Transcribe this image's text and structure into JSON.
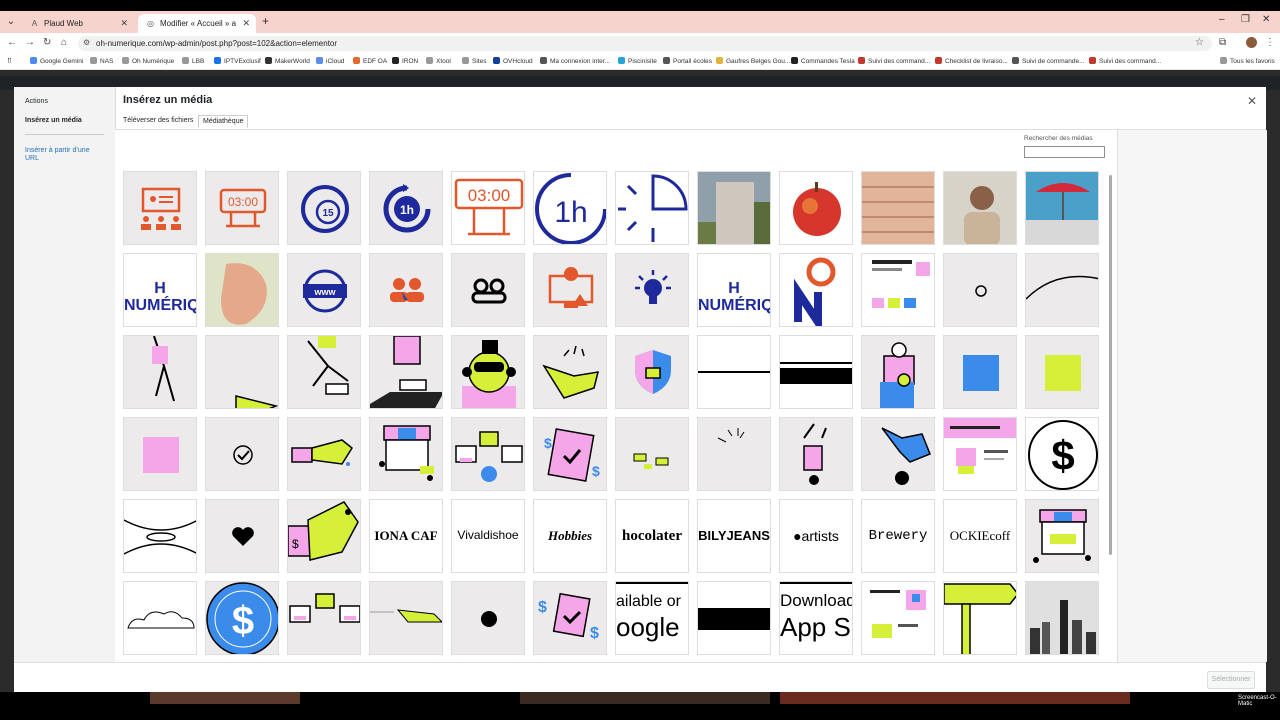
{
  "browser": {
    "tabs": [
      {
        "title": "Plaud Web",
        "icon": "plaud-icon"
      },
      {
        "title": "Modifier « Accueil » avec Elementor",
        "icon": "elementor-icon"
      }
    ],
    "url": "oh-numerique.com/wp-admin/post.php?post=102&action=elementor",
    "bookmarks": [
      "Google Gemini",
      "NAS",
      "Oh Numérique",
      "LBB",
      "IPTVExclusif",
      "MakerWorld",
      "iCloud",
      "EDF OA",
      "IRON",
      "Xtool",
      "Sites",
      "OVHcloud",
      "Ma connexion inter...",
      "Piscinisite",
      "Portail écoles",
      "Gaufres Belges Gou...",
      "Commandes Tesla",
      "Suivi des command...",
      "Checklist de livraiso...",
      "Suivi de commande...",
      "Suivi des command..."
    ],
    "all_bookmarks": "Tous les favoris"
  },
  "modal": {
    "sidebar": {
      "title": "Actions",
      "active": "Insérez un média",
      "link": "Insérer à partir d’une URL"
    },
    "title": "Insérez un média",
    "tabs": [
      "Téléverser des fichiers",
      "Médiathèque"
    ],
    "search_label": "Rechercher des médias",
    "search_value": "",
    "select_button": "Sélectionner",
    "grid_text": {
      "r2c1": "H NUMÉRIQ",
      "r2c8": "H NUMÉRIQ",
      "r5c3": "IONA CAF",
      "r5c4": "Vivaldishoe",
      "r5c5": "Hobbies",
      "r5c6": "hocolater",
      "r5c7": "BILYJEANS",
      "r5c8": "●artists",
      "r5c9": "Brewery",
      "r5c10": "OCKIEcoff",
      "r6c7a": "ailable or",
      "r6c7b": "oogle",
      "r6c9a": "Download",
      "r6c9b": "App S",
      "r1c1": "03:00",
      "r1c5": "03:00",
      "r1c6": "1h",
      "r1c4": "1h",
      "r1c3": "15",
      "r2c3": "www"
    }
  },
  "colors": {
    "orange": "#e2572b",
    "navy": "#1e2a9c",
    "pink": "#f5a6e8",
    "lime": "#d6f03a",
    "blue": "#3b8beb",
    "wp_link": "#2271b1"
  },
  "watermark": "Screencast-O-Matic"
}
